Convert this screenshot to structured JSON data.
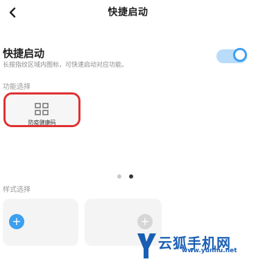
{
  "header": {
    "title": "快捷启动"
  },
  "quick_start": {
    "title": "快捷启动",
    "description": "长按指纹区域内图标，可快速启动对应功能。",
    "toggle_state": "on",
    "accent_color": "#3d9ff0"
  },
  "function_section": {
    "label": "功能选择",
    "items": [
      {
        "label": "防疫健康码",
        "icon": "grid-icon",
        "selected": true
      }
    ],
    "highlight_color": "#e03131"
  },
  "pager": {
    "pages": 2,
    "current": 2
  },
  "style_section": {
    "label": "样式选择",
    "cards": [
      {
        "icon": "add-icon",
        "active": true
      },
      {
        "icon": "add-icon",
        "active": false
      }
    ]
  },
  "watermark": {
    "brand": "云狐手机网",
    "url": "www.yunhu.net"
  }
}
